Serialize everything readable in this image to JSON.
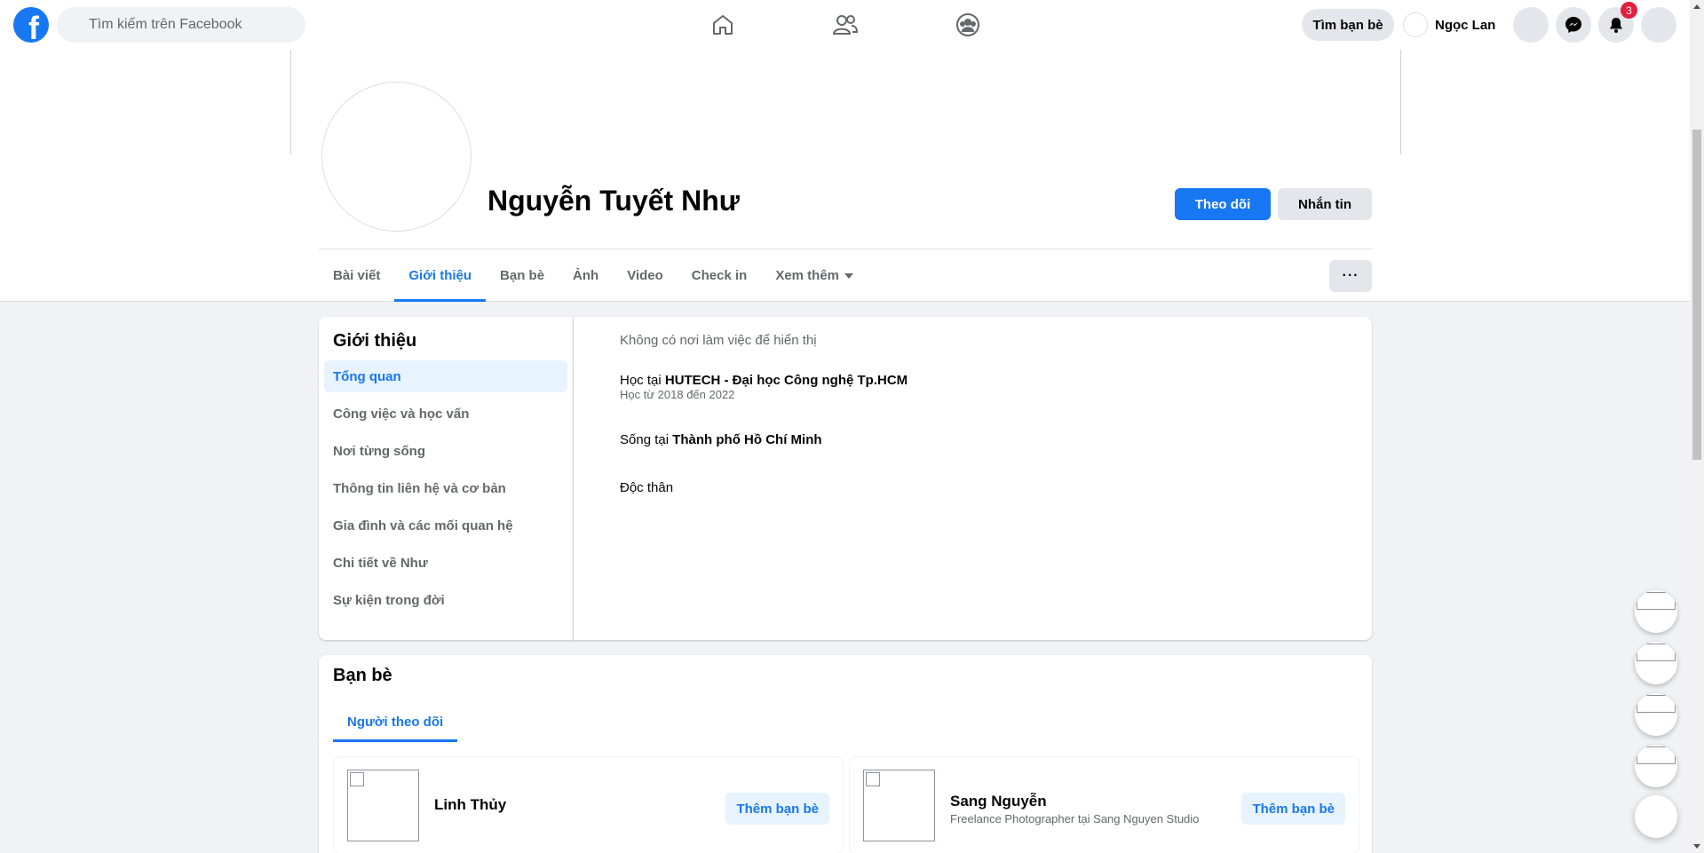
{
  "topbar": {
    "logo_letter": "f",
    "search_placeholder": "Tìm kiếm trên Facebook",
    "nav_icons": [
      "home-icon",
      "friends-icon",
      "groups-icon"
    ],
    "find_friends_label": "Tìm bạn bè",
    "user_name": "Ngọc Lan",
    "notification_count": "3",
    "brand_color": "#1877f2"
  },
  "profile": {
    "name": "Nguyễn Tuyết Như",
    "follow_label": "Theo dõi",
    "message_label": "Nhắn tin",
    "tabs": [
      {
        "label": "Bài viết",
        "active": false
      },
      {
        "label": "Giới thiệu",
        "active": true
      },
      {
        "label": "Bạn bè",
        "active": false
      },
      {
        "label": "Ảnh",
        "active": false
      },
      {
        "label": "Video",
        "active": false
      },
      {
        "label": "Check in",
        "active": false
      },
      {
        "label": "Xem thêm",
        "active": false
      }
    ],
    "more_label": "···"
  },
  "about": {
    "title": "Giới thiệu",
    "menu": [
      {
        "label": "Tổng quan",
        "active": true
      },
      {
        "label": "Công việc và học vấn",
        "active": false
      },
      {
        "label": "Nơi từng sống",
        "active": false
      },
      {
        "label": "Thông tin liên hệ và cơ bản",
        "active": false
      },
      {
        "label": "Gia đình và các mối quan hệ",
        "active": false
      },
      {
        "label": "Chi tiết về Như",
        "active": false
      },
      {
        "label": "Sự kiện trong đời",
        "active": false
      }
    ],
    "no_work": "Không có nơi làm việc để hiển thị",
    "study_prefix": "Học tại ",
    "study_school": "HUTECH - Đại học Công nghệ Tp.HCM",
    "study_period": "Học từ 2018 đến 2022",
    "live_prefix": "Sống tại ",
    "live_city": "Thành phố Hồ Chí Minh",
    "relationship": "Độc thân"
  },
  "friends": {
    "title": "Bạn bè",
    "tab_label": "Người theo dõi",
    "items": [
      {
        "name": "Linh Thủy",
        "subtitle": "",
        "button": "Thêm bạn bè"
      },
      {
        "name": "Sang Nguyễn",
        "subtitle": "Freelance Photographer tại Sang Nguyen Studio",
        "button": "Thêm bạn bè"
      }
    ]
  }
}
